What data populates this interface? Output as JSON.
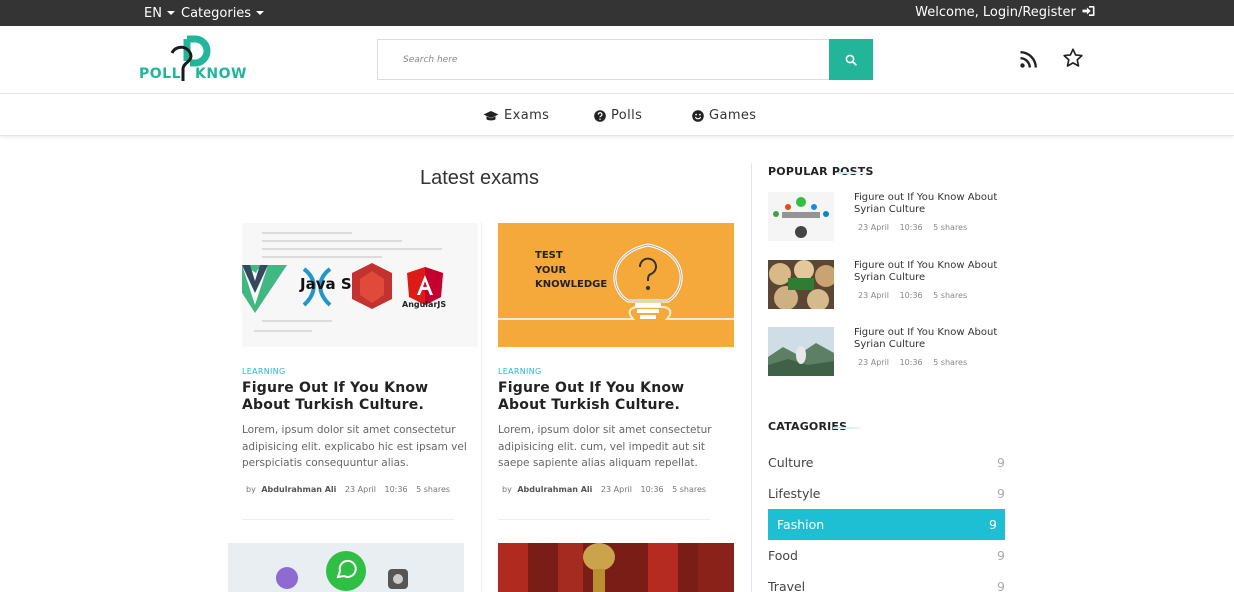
{
  "topbar": {
    "language": "EN",
    "categories_label": "Categories",
    "welcome": "Welcome, Login/Register"
  },
  "logo": {
    "left": "POLL",
    "right": "KNOW"
  },
  "search": {
    "placeholder": "Search here",
    "value": ""
  },
  "nav": {
    "items": [
      {
        "label": "Exams",
        "icon": "graduation-cap-icon"
      },
      {
        "label": "Polls",
        "icon": "question-circle-icon"
      },
      {
        "label": "Games",
        "icon": "smile-icon"
      }
    ]
  },
  "main": {
    "section_title": "Latest exams",
    "cards": [
      {
        "tag": "LEARNING",
        "title": "Figure Out If You Know About Turkish Culture.",
        "description": "Lorem, ipsum dolor sit amet consectetur adipisicing elit. explicabo hic est ipsam vel perspiciatis consequuntur alias.",
        "by": "by",
        "author": "Abdulrahman Ali",
        "date": "23 April",
        "time": "10:36",
        "shares": "5 shares",
        "image_text": "Java Script",
        "image_sub": "AngularJS"
      },
      {
        "tag": "LEARNING",
        "title": "Figure Out If You Know About Turkish Culture.",
        "description": "Lorem, ipsum dolor sit amet consectetur adipisicing elit. cum, vel impedit aut sit saepe sapiente alias aliquam repellat.",
        "by": "by",
        "author": "Abdulrahman Ali",
        "date": "23 April",
        "time": "10:36",
        "shares": "5 shares",
        "image_text": "TEST\nYOUR\nKNOWLEDGE"
      }
    ]
  },
  "sidebar": {
    "popular_title": "POPULAR POSTS",
    "posts": [
      {
        "title": "Figure out If You Know About Syrian Culture",
        "date": "23 April",
        "time": "10:36",
        "shares": "5 shares"
      },
      {
        "title": "Figure out If You Know About Syrian Culture",
        "date": "23 April",
        "time": "10:36",
        "shares": "5 shares"
      },
      {
        "title": "Figure out If You Know About Syrian Culture",
        "date": "23 April",
        "time": "10:36",
        "shares": "5 shares"
      }
    ],
    "categories_title": "CATAGORIES",
    "categories": [
      {
        "name": "Culture",
        "count": "9"
      },
      {
        "name": "Lifestyle",
        "count": "9"
      },
      {
        "name": "Fashion",
        "count": "9",
        "active": true
      },
      {
        "name": "Food",
        "count": "9"
      },
      {
        "name": "Travel",
        "count": "9"
      }
    ]
  },
  "colors": {
    "brand": "#22b59a",
    "accent": "#1fbfd3",
    "topbar": "#343434"
  }
}
